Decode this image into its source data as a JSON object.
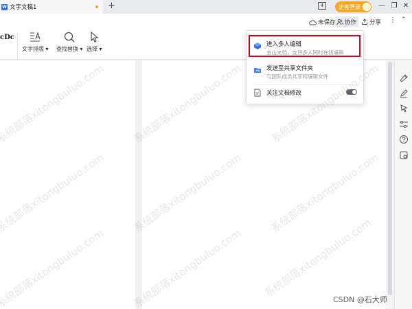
{
  "app": {
    "tab_title": "文字文稿1",
    "tab_icon_letter": "W",
    "new_tab_symbol": "+",
    "window_count": "4",
    "visitor_login": "访客登录",
    "minimize": "—",
    "restore": "❐",
    "close": "✕"
  },
  "toolbar": {
    "unsaved": "未保存",
    "collaborate": "协作",
    "share": "分享",
    "more": "⋮",
    "collapse": "⌃",
    "font_sample": "cDc",
    "tools": [
      {
        "label": "文字排版 ▾"
      },
      {
        "label": "查找替换 ▾"
      },
      {
        "label": "选择 ▾"
      }
    ]
  },
  "dropdown": {
    "items": [
      {
        "title": "进入多人编辑",
        "desc": "金山文档，支持多人同时在线编辑"
      },
      {
        "title": "发送至共享文件夹",
        "desc": "与团队成员共享和编辑文件"
      },
      {
        "title": "关注文档修改"
      }
    ],
    "toggle_on": true
  },
  "watermark": {
    "text": "系统部落xitongbuluo.com",
    "credit": "CSDN @石大师"
  },
  "colors": {
    "accent": "#2f6fe8",
    "visitor": "#f5a623",
    "highlight_border": "#d9001b",
    "toggle": "#5b6270"
  }
}
